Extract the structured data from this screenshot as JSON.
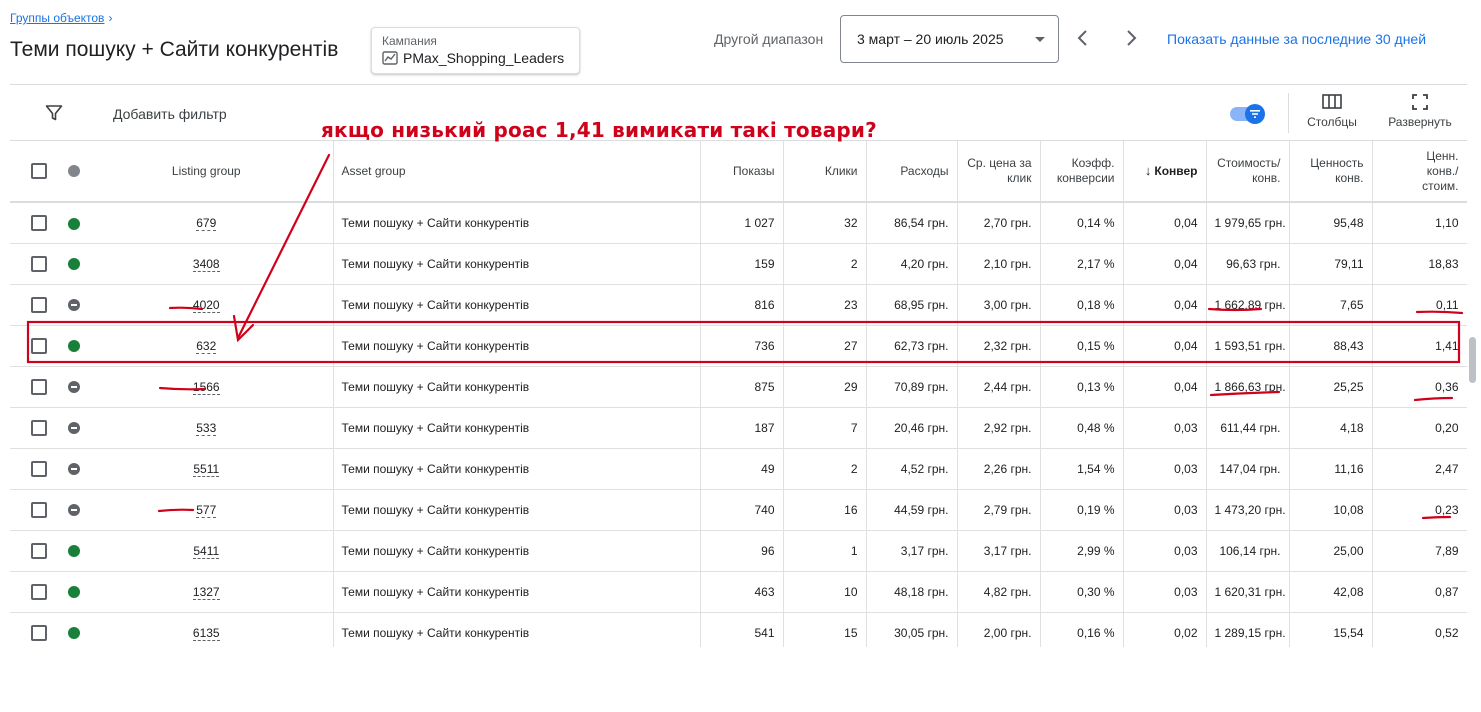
{
  "breadcrumb": {
    "label": "Группы объектов",
    "chevron": "›"
  },
  "page_title": "Теми пошуку + Сайти конкурентів",
  "campaign": {
    "label": "Кампания",
    "value": "PMax_Shopping_Leaders",
    "icon": "trend-icon"
  },
  "date_range": {
    "label": "Другой диапазон",
    "value": "3 март – 20 июль 2025"
  },
  "show_last_30": "Показать данные за последние 30 дней",
  "toolbar": {
    "add_filter": "Добавить фильтр",
    "columns": "Столбцы",
    "expand": "Развернуть"
  },
  "table": {
    "headers": {
      "listing_group": "Listing group",
      "asset_group": "Asset group",
      "impressions": "Показы",
      "clicks": "Клики",
      "cost": "Расходы",
      "avg_cpc_1": "Ср. цена за",
      "avg_cpc_2": "клик",
      "conv_rate_1": "Коэфф.",
      "conv_rate_2": "конверсии",
      "conv_arrow": "↓",
      "conversions": "Конвер",
      "cost_conv_1": "Стоимость/",
      "cost_conv_2": "конв.",
      "conv_value_1": "Ценность",
      "conv_value_2": "конв.",
      "value_cost_1": "Ценн.",
      "value_cost_2": "конв./",
      "value_cost_3": "стоим."
    },
    "rows": [
      {
        "status": "green",
        "id": "679",
        "asset_group": "Теми пошуку + Сайти конкурентів",
        "impressions": "1 027",
        "clicks": "32",
        "cost": "86,54 грн.",
        "avg_cpc": "2,70 грн.",
        "conv_rate": "0,14 %",
        "conversions": "0,04",
        "cost_conv": "1 979,65 грн.",
        "conv_value": "95,48",
        "value_cost": "1,10"
      },
      {
        "status": "green",
        "id": "3408",
        "asset_group": "Теми пошуку + Сайти конкурентів",
        "impressions": "159",
        "clicks": "2",
        "cost": "4,20 грн.",
        "avg_cpc": "2,10 грн.",
        "conv_rate": "2,17 %",
        "conversions": "0,04",
        "cost_conv": "96,63 грн.",
        "conv_value": "79,11",
        "value_cost": "18,83"
      },
      {
        "status": "paused",
        "id": "4020",
        "asset_group": "Теми пошуку + Сайти конкурентів",
        "impressions": "816",
        "clicks": "23",
        "cost": "68,95 грн.",
        "avg_cpc": "3,00 грн.",
        "conv_rate": "0,18 %",
        "conversions": "0,04",
        "cost_conv": "1 662,89 грн.",
        "conv_value": "7,65",
        "value_cost": "0,11"
      },
      {
        "status": "green",
        "id": "632",
        "asset_group": "Теми пошуку + Сайти конкурентів",
        "impressions": "736",
        "clicks": "27",
        "cost": "62,73 грн.",
        "avg_cpc": "2,32 грн.",
        "conv_rate": "0,15 %",
        "conversions": "0,04",
        "cost_conv": "1 593,51 грн.",
        "conv_value": "88,43",
        "value_cost": "1,41"
      },
      {
        "status": "paused",
        "id": "1566",
        "asset_group": "Теми пошуку + Сайти конкурентів",
        "impressions": "875",
        "clicks": "29",
        "cost": "70,89 грн.",
        "avg_cpc": "2,44 грн.",
        "conv_rate": "0,13 %",
        "conversions": "0,04",
        "cost_conv": "1 866,63 грн.",
        "conv_value": "25,25",
        "value_cost": "0,36"
      },
      {
        "status": "paused",
        "id": "533",
        "asset_group": "Теми пошуку + Сайти конкурентів",
        "impressions": "187",
        "clicks": "7",
        "cost": "20,46 грн.",
        "avg_cpc": "2,92 грн.",
        "conv_rate": "0,48 %",
        "conversions": "0,03",
        "cost_conv": "611,44 грн.",
        "conv_value": "4,18",
        "value_cost": "0,20"
      },
      {
        "status": "paused",
        "id": "5511",
        "asset_group": "Теми пошуку + Сайти конкурентів",
        "impressions": "49",
        "clicks": "2",
        "cost": "4,52 грн.",
        "avg_cpc": "2,26 грн.",
        "conv_rate": "1,54 %",
        "conversions": "0,03",
        "cost_conv": "147,04 грн.",
        "conv_value": "11,16",
        "value_cost": "2,47"
      },
      {
        "status": "paused",
        "id": "577",
        "asset_group": "Теми пошуку + Сайти конкурентів",
        "impressions": "740",
        "clicks": "16",
        "cost": "44,59 грн.",
        "avg_cpc": "2,79 грн.",
        "conv_rate": "0,19 %",
        "conversions": "0,03",
        "cost_conv": "1 473,20 грн.",
        "conv_value": "10,08",
        "value_cost": "0,23"
      },
      {
        "status": "green",
        "id": "5411",
        "asset_group": "Теми пошуку + Сайти конкурентів",
        "impressions": "96",
        "clicks": "1",
        "cost": "3,17 грн.",
        "avg_cpc": "3,17 грн.",
        "conv_rate": "2,99 %",
        "conversions": "0,03",
        "cost_conv": "106,14 грн.",
        "conv_value": "25,00",
        "value_cost": "7,89"
      },
      {
        "status": "green",
        "id": "1327",
        "asset_group": "Теми пошуку + Сайти конкурентів",
        "impressions": "463",
        "clicks": "10",
        "cost": "48,18 грн.",
        "avg_cpc": "4,82 грн.",
        "conv_rate": "0,30 %",
        "conversions": "0,03",
        "cost_conv": "1 620,31 грн.",
        "conv_value": "42,08",
        "value_cost": "0,87"
      },
      {
        "status": "green",
        "id": "6135",
        "asset_group": "Теми пошуку + Сайти конкурентів",
        "impressions": "541",
        "clicks": "15",
        "cost": "30,05 грн.",
        "avg_cpc": "2,00 грн.",
        "conv_rate": "0,16 %",
        "conversions": "0,02",
        "cost_conv": "1 289,15 грн.",
        "conv_value": "15,54",
        "value_cost": "0,52"
      }
    ]
  },
  "annotation": {
    "text": "якщо низький роас 1,41 вимикати такі товари?",
    "color": "#d0021b"
  },
  "colors": {
    "accent": "#1a73e8",
    "enabled": "#188038",
    "paused": "#5f6368",
    "annotation": "#d0021b"
  }
}
